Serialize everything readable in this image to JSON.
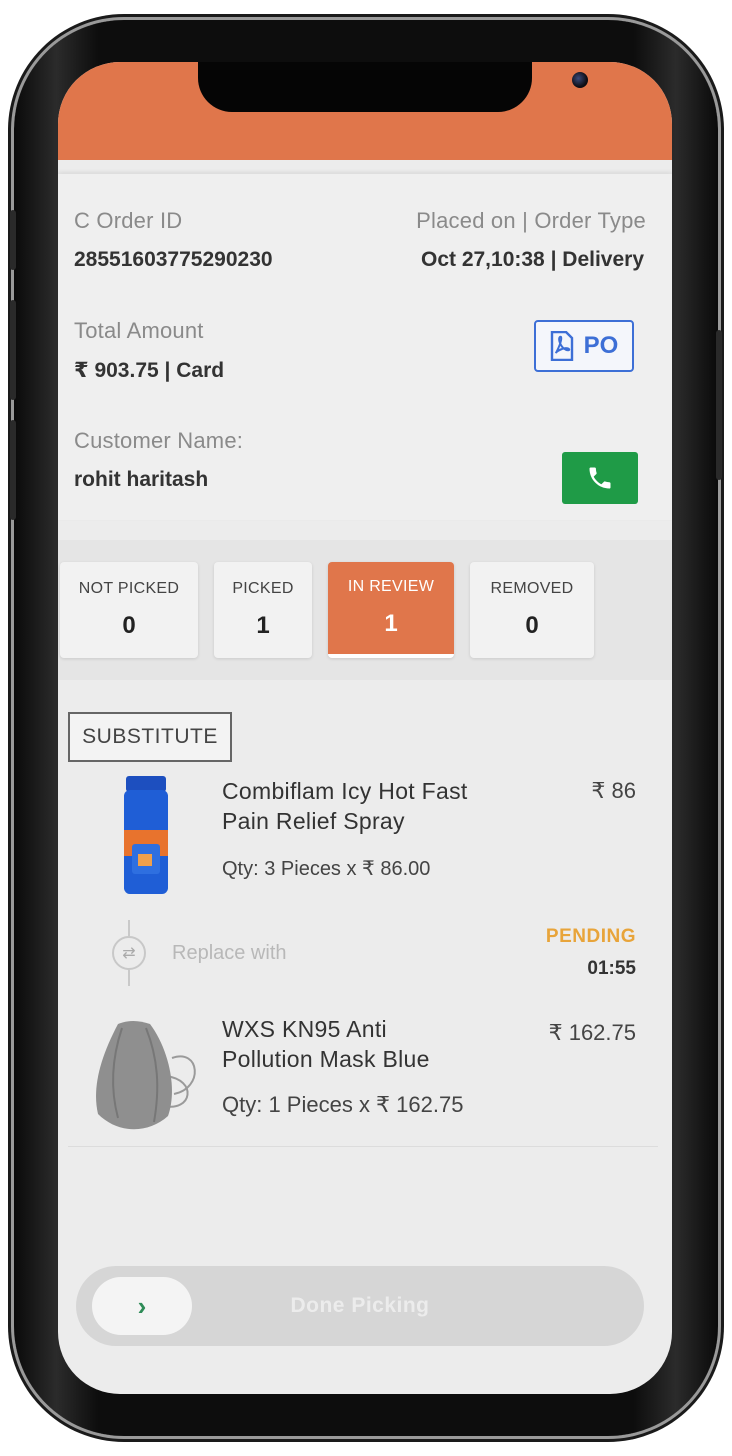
{
  "order": {
    "c_order_id_label": "C Order ID",
    "c_order_id": "28551603775290230",
    "placed_label": "Placed on | Order Type",
    "placed_value": "Oct 27,10:38 | Delivery",
    "total_label": "Total Amount",
    "total_value": "₹ 903.75 | Card",
    "po_label": "PO",
    "customer_label": "Customer Name:",
    "customer_name": "rohit haritash"
  },
  "tabs": [
    {
      "label": "NOT PICKED",
      "count": "0",
      "active": false
    },
    {
      "label": "PICKED",
      "count": "1",
      "active": false
    },
    {
      "label": "IN REVIEW",
      "count": "1",
      "active": true
    },
    {
      "label": "REMOVED",
      "count": "0",
      "active": false
    }
  ],
  "substitute": {
    "tag": "SUBSTITUTE",
    "original": {
      "name_line1": "Combiflam Icy Hot Fast",
      "name_line2": "Pain Relief Spray",
      "price": "₹ 86",
      "qty": "Qty: 3 Pieces x ₹ 86.00"
    },
    "replace_label": "Replace with",
    "status": "PENDING",
    "timer": "01:55",
    "replacement": {
      "name_line1": "WXS KN95 Anti",
      "name_line2": "Pollution Mask Blue",
      "price": "₹ 162.75",
      "qty": "Qty: 1 Pieces x ₹ 162.75"
    }
  },
  "footer": {
    "done_label": "Done Picking",
    "handle_icon": "chevron-right-icon"
  },
  "colors": {
    "accent": "#e0764b",
    "call_green": "#1f9b47",
    "po_blue": "#3d6fd6",
    "pending_amber": "#e8a43a"
  }
}
